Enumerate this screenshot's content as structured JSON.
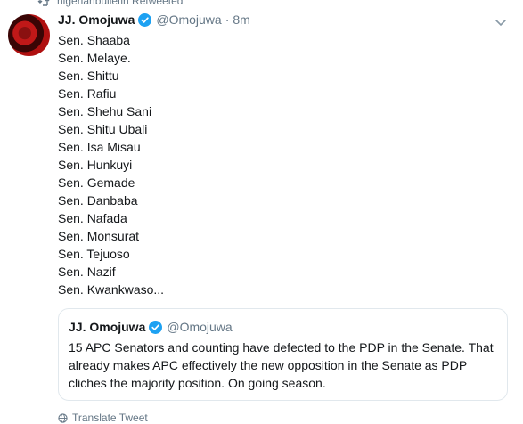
{
  "retweet_context": {
    "text": "nigerianbulletin Retweeted"
  },
  "tweet": {
    "author_name": "JJ. Omojuwa",
    "handle": "@Omojuwa",
    "separator": "·",
    "time": "8m",
    "lines": [
      "Sen. Shaaba",
      "Sen. Melaye.",
      "Sen. Shittu",
      "Sen. Rafiu",
      "Sen. Shehu Sani",
      "Sen. Shitu Ubali",
      "Sen. Isa Misau",
      "Sen. Hunkuyi",
      "Sen. Gemade",
      "Sen. Danbaba",
      "Sen. Nafada",
      "Sen. Monsurat",
      "Sen. Tejuoso",
      "Sen. Nazif",
      "Sen. Kwankwaso..."
    ]
  },
  "quoted_tweet": {
    "author_name": "JJ. Omojuwa",
    "handle": "@Omojuwa",
    "text": "15 APC Senators and counting have defected to the PDP in the Senate. That already makes APC effectively the new opposition in the Senate as PDP cliches the majority position. On going season."
  },
  "translate": {
    "label": "Translate Tweet"
  },
  "colors": {
    "verified": "#1da1f2",
    "muted": "#657786",
    "text": "#14171a",
    "border": "#e1e8ed"
  }
}
